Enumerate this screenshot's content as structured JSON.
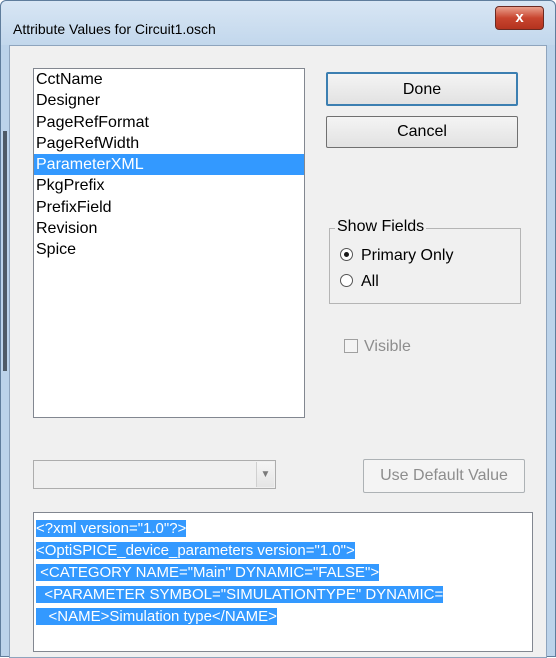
{
  "window": {
    "title": "Attribute Values for  Circuit1.osch",
    "close_label": "x"
  },
  "attributes": {
    "items": [
      "CctName",
      "Designer",
      "PageRefFormat",
      "PageRefWidth",
      "ParameterXML",
      "PkgPrefix",
      "PrefixField",
      "Revision",
      "Spice"
    ],
    "selected": "ParameterXML"
  },
  "buttons": {
    "done": "Done",
    "cancel": "Cancel",
    "use_default": "Use Default Value"
  },
  "show_fields": {
    "label": "Show Fields",
    "options": [
      {
        "label": "Primary Only",
        "checked": true
      },
      {
        "label": "All",
        "checked": false
      }
    ]
  },
  "visible": {
    "label": "Visible",
    "checked": false,
    "enabled": false
  },
  "value_combo": {
    "value": ""
  },
  "value_text": {
    "lines": [
      "<?xml version=\"1.0\"?>",
      "<OptiSPICE_device_parameters version=\"1.0\">",
      " <CATEGORY NAME=\"Main\" DYNAMIC=\"FALSE\">",
      "  <PARAMETER SYMBOL=\"SIMULATIONTYPE\" DYNAMIC=",
      "   <NAME>Simulation type</NAME>"
    ]
  },
  "colors": {
    "selection": "#3399ff",
    "title_bar": "#c2d7ec",
    "close_button": "#c8452f"
  }
}
